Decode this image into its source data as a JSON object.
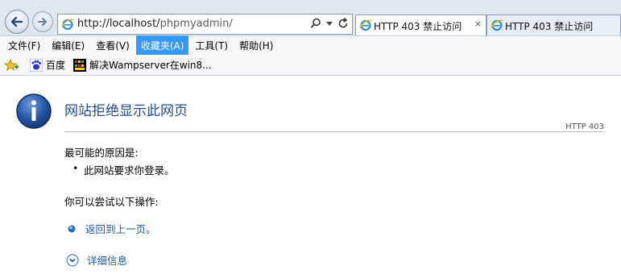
{
  "window": {
    "address_host": "http://localhost/",
    "address_path": "phpmyadmin/",
    "tabs": [
      {
        "label": "HTTP 403 禁止访问",
        "close": "×"
      },
      {
        "label": "HTTP 403 禁止访问"
      }
    ]
  },
  "menubar": {
    "items": [
      "文件(F)",
      "编辑(E)",
      "查看(V)",
      "收藏夹(A)",
      "工具(T)",
      "帮助(H)"
    ]
  },
  "favorites": {
    "items": [
      "百度",
      "解决Wampserver在win8..."
    ]
  },
  "page": {
    "title": "网站拒绝显示此网页",
    "code": "HTTP 403",
    "reason_heading": "最可能的原因是:",
    "reason_bullet": "•",
    "reason": "此网站要求你登录。",
    "try_heading": "你可以尝试以下操作:",
    "back_link": "返回到上一页。",
    "details_link": "详细信息"
  },
  "colors": {
    "title": "#1f4e8c",
    "link": "#1f5aa6",
    "menu_highlight": "#3399ff"
  }
}
